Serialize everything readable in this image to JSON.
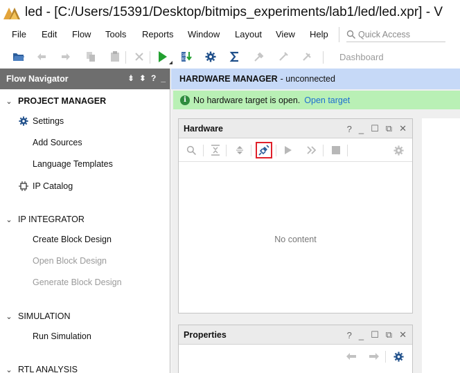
{
  "window": {
    "title": "led - [C:/Users/15391/Desktop/bitmips_experiments/lab1/led/led.xpr] - V"
  },
  "menu": {
    "items": [
      "File",
      "Edit",
      "Flow",
      "Tools",
      "Reports",
      "Window",
      "Layout",
      "View",
      "Help"
    ],
    "quick_access_placeholder": "Quick Access"
  },
  "toolbar": {
    "dashboard_label": "Dashboard",
    "icons": [
      "open-project-icon",
      "undo-icon",
      "redo-icon",
      "copy-icon",
      "paste-icon",
      "delete-icon",
      "run-icon",
      "program-device-icon",
      "settings-icon",
      "sigma-icon",
      "tool-disabled-icon",
      "tool-disabled-icon",
      "tool-disabled-icon"
    ]
  },
  "flow_navigator": {
    "title": "Flow Navigator",
    "sections": {
      "project_manager": "PROJECT MANAGER",
      "ip_integrator": "IP INTEGRATOR",
      "simulation": "SIMULATION",
      "rtl_analysis": "RTL ANALYSIS"
    },
    "items": {
      "settings": "Settings",
      "add_sources": "Add Sources",
      "language_templates": "Language Templates",
      "ip_catalog": "IP Catalog",
      "create_block_design": "Create Block Design",
      "open_block_design": "Open Block Design",
      "generate_block_design": "Generate Block Design",
      "run_simulation": "Run Simulation"
    }
  },
  "hardware_manager": {
    "title": "HARDWARE MANAGER",
    "status": "- unconnected",
    "info_message": "No hardware target is open.",
    "open_target_link": "Open target"
  },
  "hardware_panel": {
    "title": "Hardware",
    "empty_text": "No content"
  },
  "properties_panel": {
    "title": "Properties"
  },
  "colors": {
    "flow_nav_header": "#6e6e6e",
    "hm_header": "#c6d9f7",
    "info_bar": "#b9f0b5",
    "link": "#1c6ed1",
    "highlight": "#e0202a",
    "run_green": "#22a030"
  }
}
